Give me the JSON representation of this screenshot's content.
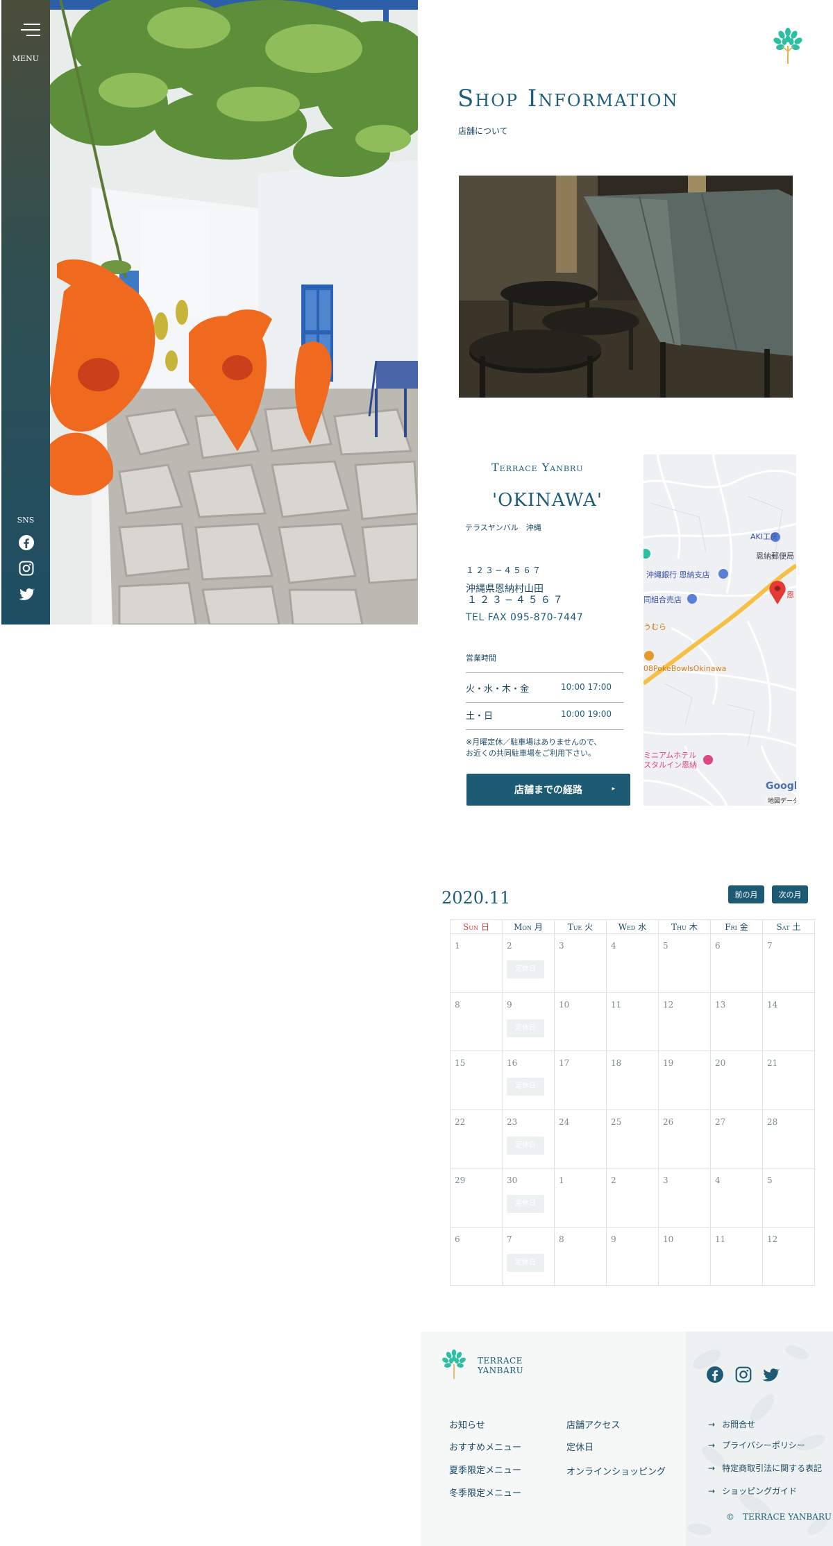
{
  "sidebar": {
    "menu_label": "MENU",
    "sns_label": "SNS",
    "icons": [
      "facebook-icon",
      "instagram-icon",
      "twitter-icon"
    ]
  },
  "header": {
    "title_en": "Shop Information",
    "title_ja": "店舗について"
  },
  "shop": {
    "name_en": "Terrace Yanbru",
    "name_area": "'OKINAWA'",
    "name_kana": "テラスヤンバル　沖縄",
    "zip": "１２３−４５６７",
    "address_line1": "沖縄県恩納村山田",
    "address_line2": "１２３−４５６７",
    "tel": "TEL FAX  095-870-7447",
    "hours_title": "営業時間",
    "hours": [
      {
        "days": "火・水・木・金",
        "time": "10:00 17:00"
      },
      {
        "days": "土・日",
        "time": "10:00 19:00"
      }
    ],
    "notice_line1": "※月曜定休／駐車場はありませんので、",
    "notice_line2": "お近くの共同駐車場をご利用下さい。",
    "route_button": "店舗までの経路",
    "route_arrow": "▸"
  },
  "map": {
    "labels": {
      "aki": "AKI工房",
      "post": "恩納郵便局",
      "bank": "沖縄銀行 恩納支店",
      "coop": "同組合売店",
      "mura": "うむら",
      "poke": "08PokeBowlsOkinawa",
      "marker": "恩",
      "hotel1": "ミニアムホテル",
      "hotel2": "スタルイン恩納",
      "google": "Google",
      "mapdata": "地図データ"
    },
    "colors": {
      "road": "#f5c043",
      "pin": "#e53935",
      "poi_blue": "#5a7fd6",
      "poi_orange": "#e39a2b",
      "poi_pink": "#d94a7a"
    }
  },
  "calendar": {
    "month": "2020.11",
    "prev_label": "前の月",
    "next_label": "次の月",
    "weekdays": [
      {
        "en": "Sun",
        "ja": "日",
        "cls": "sun"
      },
      {
        "en": "Mon",
        "ja": "月",
        "cls": ""
      },
      {
        "en": "Tue",
        "ja": "火",
        "cls": ""
      },
      {
        "en": "Wed",
        "ja": "水",
        "cls": ""
      },
      {
        "en": "Thu",
        "ja": "木",
        "cls": ""
      },
      {
        "en": "Fri",
        "ja": "金",
        "cls": ""
      },
      {
        "en": "Sat",
        "ja": "土",
        "cls": "sat"
      }
    ],
    "closed_label": "定休日",
    "weeks": [
      [
        {
          "d": "1"
        },
        {
          "d": "2",
          "closed": true
        },
        {
          "d": "3"
        },
        {
          "d": "4"
        },
        {
          "d": "5"
        },
        {
          "d": "6"
        },
        {
          "d": "7"
        }
      ],
      [
        {
          "d": "8"
        },
        {
          "d": "9",
          "closed": true
        },
        {
          "d": "10"
        },
        {
          "d": "11"
        },
        {
          "d": "12"
        },
        {
          "d": "13"
        },
        {
          "d": "14"
        }
      ],
      [
        {
          "d": "15"
        },
        {
          "d": "16",
          "closed": true
        },
        {
          "d": "17"
        },
        {
          "d": "18"
        },
        {
          "d": "19"
        },
        {
          "d": "20"
        },
        {
          "d": "21"
        }
      ],
      [
        {
          "d": "22"
        },
        {
          "d": "23",
          "closed": true
        },
        {
          "d": "24"
        },
        {
          "d": "25"
        },
        {
          "d": "26"
        },
        {
          "d": "27"
        },
        {
          "d": "28"
        }
      ],
      [
        {
          "d": "29"
        },
        {
          "d": "30",
          "closed": true
        },
        {
          "d": "1"
        },
        {
          "d": "2"
        },
        {
          "d": "3"
        },
        {
          "d": "4"
        },
        {
          "d": "5"
        }
      ],
      [
        {
          "d": "6"
        },
        {
          "d": "7",
          "closed": true
        },
        {
          "d": "8"
        },
        {
          "d": "9"
        },
        {
          "d": "10"
        },
        {
          "d": "11"
        },
        {
          "d": "12"
        }
      ]
    ]
  },
  "footer": {
    "brand_line1": "TERRACE",
    "brand_line2": "YANBARU",
    "nav_col1": [
      "お知らせ",
      "おすすめメニュー",
      "夏季限定メニュー",
      "冬季限定メニュー"
    ],
    "nav_col2": [
      "店舗アクセス",
      "定休日",
      "オンラインショッピング"
    ],
    "sub_links": [
      "お問合せ",
      "プライバシーポリシー",
      "特定商取引法に関する表記",
      "ショッピングガイド"
    ],
    "arrow": "→",
    "copyright": "©　TERRACE YANBARU",
    "icons": [
      "facebook-icon",
      "instagram-icon",
      "twitter-icon"
    ]
  },
  "colors": {
    "brand": "#1d5a73",
    "accent_teal": "#2bbfa4",
    "sunday": "#d64040"
  }
}
